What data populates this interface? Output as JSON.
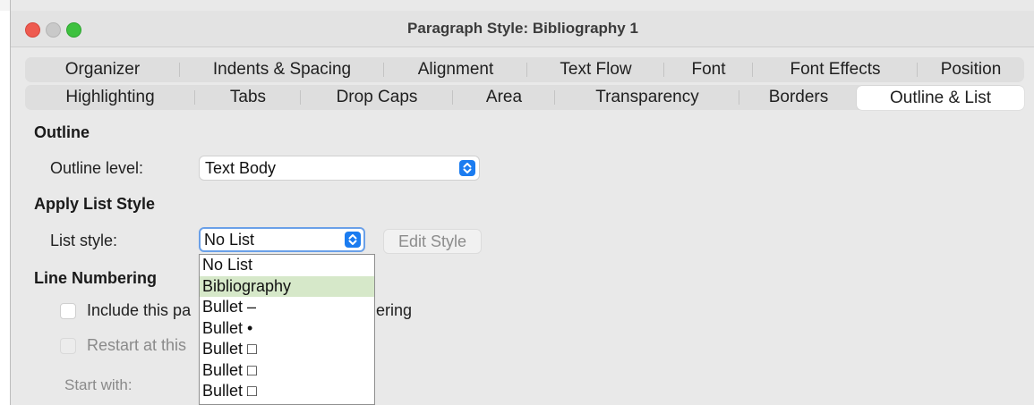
{
  "window": {
    "title": "Paragraph Style: Bibliography 1"
  },
  "tabs_row1": [
    "Organizer",
    "Indents & Spacing",
    "Alignment",
    "Text Flow",
    "Font",
    "Font Effects",
    "Position"
  ],
  "tabs_row2": [
    "Highlighting",
    "Tabs",
    "Drop Caps",
    "Area",
    "Transparency",
    "Borders",
    "Outline & List"
  ],
  "active_tab": "Outline & List",
  "outline": {
    "heading": "Outline",
    "level_label": "Outline level:",
    "level_value": "Text Body"
  },
  "list_style": {
    "heading": "Apply List Style",
    "label": "List style:",
    "value": "No List",
    "edit_button": "Edit Style",
    "options": [
      "No List",
      "Bibliography",
      "Bullet –",
      "Bullet •",
      "Bullet □",
      "Bullet □",
      "Bullet □"
    ],
    "highlighted_option": "Bibliography"
  },
  "line_numbering": {
    "heading": "Line Numbering",
    "include_prefix": "Include this pa",
    "include_suffix": "ering",
    "restart_prefix": "Restart at this",
    "start_with_label": "Start with:"
  },
  "colors": {
    "accent": "#1b7cf0",
    "highlight": "#d6e8c9",
    "close": "#ee5b50",
    "maximize": "#3ec13f"
  }
}
